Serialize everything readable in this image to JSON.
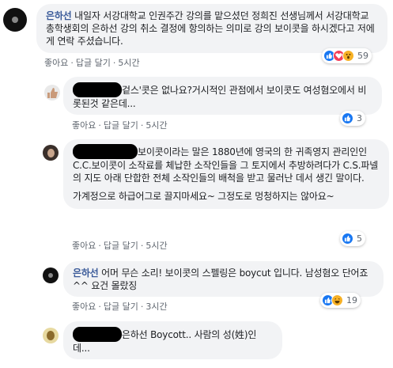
{
  "actions": {
    "like": "좋아요",
    "reply": "답글 달기",
    "sep": "·"
  },
  "comments": [
    {
      "author": "은하선",
      "text": " 내일자 서강대학교 인권주간 강의를 맡으셨던 정희진 선생님께서 서강대학교 총학생회의 은하선 강의 취소 결정에 항의하는 의미로 강의 보이콧을 하시겠다고 저에게 연락 주셨습니다.",
      "time": "5시간",
      "reactions": {
        "icons": [
          "like-icon",
          "love-icon",
          "wow-icon"
        ],
        "count": "59"
      }
    },
    {
      "author_redacted": true,
      "text": "겉스'콧은 없나요?거시적인 관점에서 보이콧도 여성혐오에서 비롯된것 같은데...",
      "time": "5시간",
      "reactions": {
        "icons": [
          "like-icon"
        ],
        "count": "3"
      }
    },
    {
      "author_redacted": true,
      "text": "보이콧이라는 말은 1880년에 영국의 한 귀족영지 관리인인 C.C.보이콧이 소작료를 체납한 소작인들을 그 토지에서 추방하려다가 C.S.파넬의 지도 아래 단합한 전체 소작인들의 배척을 받고 물러난 데서 생긴 말이다.",
      "text2": "가계정으로 하급어그로 끌지마세요~ 그정도로 멍청하지는 않아요~",
      "time": "5시간",
      "reactions": {
        "icons": [
          "like-icon"
        ],
        "count": "5"
      }
    },
    {
      "author": "은하선",
      "text": " 어머 무슨 소리! 보이콧의 스펠링은 boycut 입니다. 남성혐오 단어죠 ^^ 요건 몰랐징",
      "time": "3시간",
      "reactions": {
        "icons": [
          "like-icon",
          "haha-icon"
        ],
        "count": "19"
      }
    },
    {
      "author_redacted": true,
      "text": "은하선 Boycott.. 사람의 성(姓)인데..."
    }
  ],
  "colors": {
    "author": "#385898",
    "like": "#1877f2",
    "love": "#f33e58",
    "wow": "#f7b125"
  }
}
